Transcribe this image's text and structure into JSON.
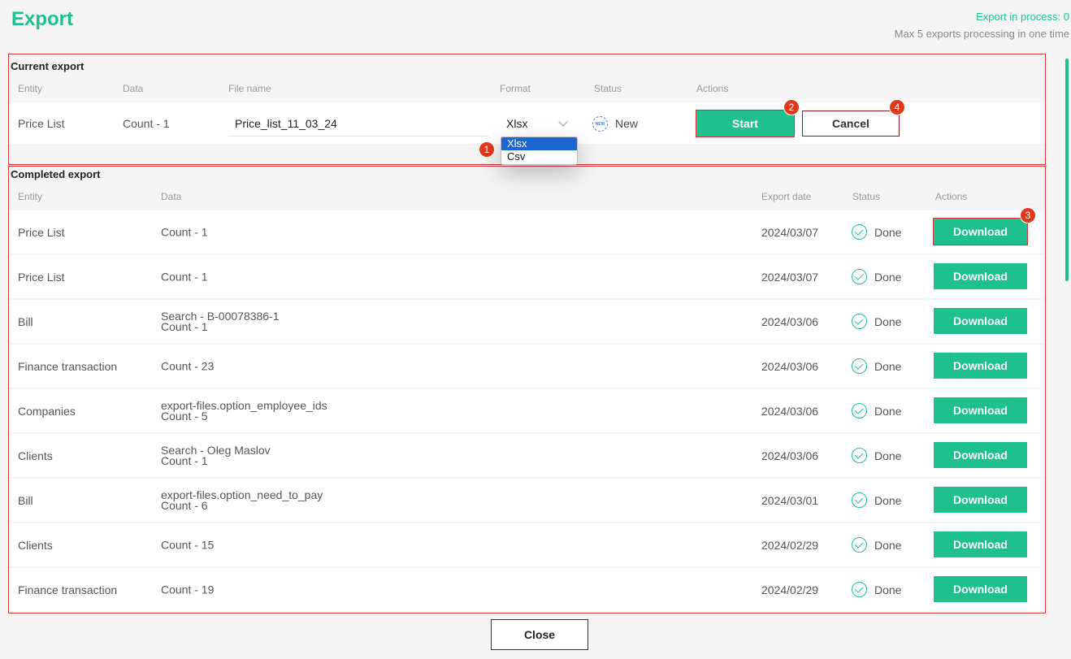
{
  "header": {
    "title": "Export",
    "in_process": "Export in process: 0",
    "max_note": "Max 5 exports processing in one time"
  },
  "current": {
    "title": "Current export",
    "columns": [
      "Entity",
      "Data",
      "File name",
      "Format",
      "Status",
      "Actions"
    ],
    "row": {
      "entity": "Price List",
      "data": "Count - 1",
      "file_name": "Price_list_11_03_24",
      "format": "Xlsx",
      "status_icon_text": "NEW",
      "status": "New",
      "start_label": "Start",
      "cancel_label": "Cancel"
    },
    "format_options": [
      "Xlsx",
      "Csv"
    ]
  },
  "completed": {
    "title": "Completed export",
    "columns": [
      "Entity",
      "Data",
      "Export date",
      "Status",
      "Actions"
    ],
    "rows": [
      {
        "entity": "Price List",
        "data": [
          "Count - 1"
        ],
        "date": "2024/03/07",
        "status": "Done",
        "action": "Download"
      },
      {
        "entity": "Price List",
        "data": [
          "Count - 1"
        ],
        "date": "2024/03/07",
        "status": "Done",
        "action": "Download"
      },
      {
        "entity": "Bill",
        "data": [
          "Search - B-00078386-1",
          "Count - 1"
        ],
        "date": "2024/03/06",
        "status": "Done",
        "action": "Download"
      },
      {
        "entity": "Finance transaction",
        "data": [
          "Count - 23"
        ],
        "date": "2024/03/06",
        "status": "Done",
        "action": "Download"
      },
      {
        "entity": "Companies",
        "data": [
          "export-files.option_employee_ids",
          "Count - 5"
        ],
        "date": "2024/03/06",
        "status": "Done",
        "action": "Download"
      },
      {
        "entity": "Clients",
        "data": [
          "Search - Oleg Maslov",
          "Count - 1"
        ],
        "date": "2024/03/06",
        "status": "Done",
        "action": "Download"
      },
      {
        "entity": "Bill",
        "data": [
          "export-files.option_need_to_pay",
          "Count - 6"
        ],
        "date": "2024/03/01",
        "status": "Done",
        "action": "Download"
      },
      {
        "entity": "Clients",
        "data": [
          "Count - 15"
        ],
        "date": "2024/02/29",
        "status": "Done",
        "action": "Download"
      },
      {
        "entity": "Finance transaction",
        "data": [
          "Count - 19"
        ],
        "date": "2024/02/29",
        "status": "Done",
        "action": "Download"
      }
    ]
  },
  "badges": [
    "1",
    "2",
    "3",
    "4"
  ],
  "footer": {
    "close_label": "Close"
  },
  "colors": {
    "accent": "#1ec08e",
    "highlight": "#d3343a",
    "badge": "#e0391e",
    "select": "#1a67d2"
  }
}
